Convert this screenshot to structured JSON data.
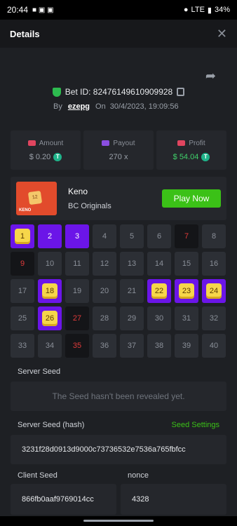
{
  "status": {
    "time": "20:44",
    "battery": "34%",
    "network": "LTE"
  },
  "header": {
    "title": "Details"
  },
  "bet": {
    "id_label": "Bet ID: 82476149610909928",
    "by": "By",
    "user": "ezepg",
    "on": "On",
    "date": "30/4/2023, 19:09:56"
  },
  "stats": {
    "amount_label": "Amount",
    "amount_value": "$ 0.20",
    "payout_label": "Payout",
    "payout_value": "270 x",
    "profit_label": "Profit",
    "profit_value": "$ 54.04"
  },
  "game": {
    "name": "Keno",
    "provider": "BC Originals",
    "play_label": "Play Now",
    "thumb_tile": "12",
    "thumb_text": "KENO"
  },
  "grid": [
    {
      "n": "1",
      "s": "hit"
    },
    {
      "n": "2",
      "s": "sel"
    },
    {
      "n": "3",
      "s": "sel"
    },
    {
      "n": "4",
      "s": ""
    },
    {
      "n": "5",
      "s": ""
    },
    {
      "n": "6",
      "s": ""
    },
    {
      "n": "7",
      "s": "miss"
    },
    {
      "n": "8",
      "s": ""
    },
    {
      "n": "9",
      "s": "miss"
    },
    {
      "n": "10",
      "s": ""
    },
    {
      "n": "11",
      "s": ""
    },
    {
      "n": "12",
      "s": ""
    },
    {
      "n": "13",
      "s": ""
    },
    {
      "n": "14",
      "s": ""
    },
    {
      "n": "15",
      "s": ""
    },
    {
      "n": "16",
      "s": ""
    },
    {
      "n": "17",
      "s": ""
    },
    {
      "n": "18",
      "s": "hit"
    },
    {
      "n": "19",
      "s": ""
    },
    {
      "n": "20",
      "s": ""
    },
    {
      "n": "21",
      "s": ""
    },
    {
      "n": "22",
      "s": "hit"
    },
    {
      "n": "23",
      "s": "hit"
    },
    {
      "n": "24",
      "s": "hit"
    },
    {
      "n": "25",
      "s": ""
    },
    {
      "n": "26",
      "s": "hit"
    },
    {
      "n": "27",
      "s": "miss"
    },
    {
      "n": "28",
      "s": ""
    },
    {
      "n": "29",
      "s": ""
    },
    {
      "n": "30",
      "s": ""
    },
    {
      "n": "31",
      "s": ""
    },
    {
      "n": "32",
      "s": ""
    },
    {
      "n": "33",
      "s": ""
    },
    {
      "n": "34",
      "s": ""
    },
    {
      "n": "35",
      "s": "miss"
    },
    {
      "n": "36",
      "s": ""
    },
    {
      "n": "37",
      "s": ""
    },
    {
      "n": "38",
      "s": ""
    },
    {
      "n": "39",
      "s": ""
    },
    {
      "n": "40",
      "s": ""
    }
  ],
  "seeds": {
    "server_label": "Server Seed",
    "server_value": "The Seed hasn't been revealed yet.",
    "hash_label": "Server Seed (hash)",
    "settings_label": "Seed Settings",
    "hash_value": "3231f28d0913d9000c73736532e7536a765fbfcc",
    "client_label": "Client Seed",
    "client_value": "866fb0aaf9769014cc",
    "nonce_label": "nonce",
    "nonce_value": "4328"
  },
  "colors": {
    "accent_green": "#3bc117",
    "selected_purple": "#6b15e8",
    "miss_red": "#e03a3a"
  }
}
